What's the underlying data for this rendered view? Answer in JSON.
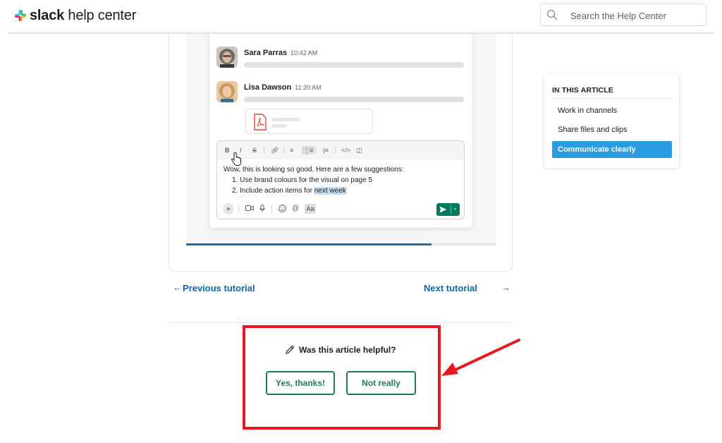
{
  "header": {
    "logo_brand": "slack",
    "logo_suffix": "help center",
    "search_placeholder": "Search the Help Center"
  },
  "tutorial_image": {
    "messages": [
      {
        "name": "Sara Parras",
        "time": "10:42 AM"
      },
      {
        "name": "Lisa Dawson",
        "time": "11:20 AM"
      }
    ],
    "toolbar": [
      "B",
      "I",
      "S",
      "link",
      "ol",
      "ul",
      "quote",
      "code",
      "code-block"
    ],
    "composer_lines": [
      "Wow, this is looking so good. Here are a few suggestions:",
      "1.  Use brand colours for the visual on page 5",
      "2.  Include action items for ",
      "next week"
    ],
    "composer_icons": [
      "plus-icon",
      "video-icon",
      "mic-icon",
      "emoji-icon",
      "mention-icon"
    ],
    "format_label": "Aa",
    "progress_fraction": 0.79
  },
  "nav": {
    "previous": "Previous tutorial",
    "next": "Next tutorial"
  },
  "feedback": {
    "question": "Was this article helpful?",
    "yes": "Yes, thanks!",
    "no": "Not really"
  },
  "toc": {
    "title": "IN THIS ARTICLE",
    "items": [
      "Work in channels",
      "Share files and clips",
      "Communicate clearly"
    ],
    "active_index": 2
  },
  "colors": {
    "link": "#1264a3",
    "feedback_green": "#1f7a5f",
    "annotation_red": "#e8181e",
    "toc_active": "#2c9ce0",
    "send_green": "#007a5a"
  }
}
